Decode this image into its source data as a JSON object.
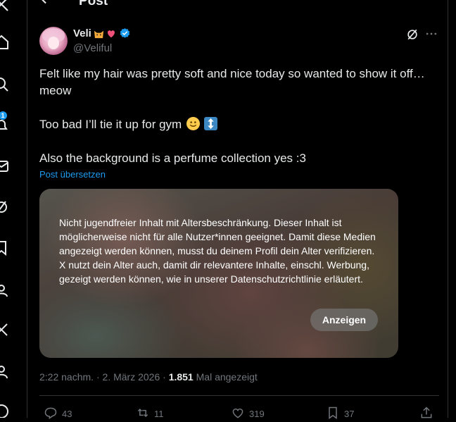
{
  "header": {
    "title": "Post"
  },
  "nav": {
    "notification_count": "1"
  },
  "author": {
    "name": "Veli",
    "handle": "@Veliful"
  },
  "post": {
    "line1": "Felt like my hair was pretty soft and nice today so wanted to show it off…",
    "line2": "meow",
    "line3": "Too bad I’ll tie it up for gym",
    "line4": "Also the background is a perfume collection yes :3",
    "translate_label": "Post übersetzen"
  },
  "media": {
    "warning": "Nicht jugendfreier Inhalt mit Altersbeschränkung. Dieser Inhalt ist möglicherweise nicht für alle Nutzer*innen geeignet. Damit diese Medien angezeigt werden können, musst du deinem Profil dein Alter verifizieren. X nutzt dein Alter auch, damit dir relevantere Inhalte, einschl. Werbung, gezeigt werden können, wie in unserer Datenschutzrichtlinie erläutert.",
    "show_label": "Anzeigen"
  },
  "meta": {
    "time": "2:22 nachm.",
    "separator": " · ",
    "date": "2. März 2026",
    "views_count": "1.851",
    "views_label": "Mal angezeigt"
  },
  "actions": {
    "replies": "43",
    "reposts": "11",
    "likes": "319",
    "bookmarks": "37"
  },
  "colors": {
    "background": "#000000",
    "text": "#e7e9ea",
    "secondary": "#71767b",
    "accent": "#1d9bf0",
    "verified": "#1d9bf0"
  },
  "icons": [
    "back-arrow-icon",
    "grok-icon",
    "more-icon",
    "reply-icon",
    "repost-icon",
    "like-icon",
    "bookmark-icon",
    "share-icon",
    "verified-icon",
    "cat-emoji",
    "heart-emoji",
    "smile-emoji",
    "up-down-arrow-emoji"
  ]
}
